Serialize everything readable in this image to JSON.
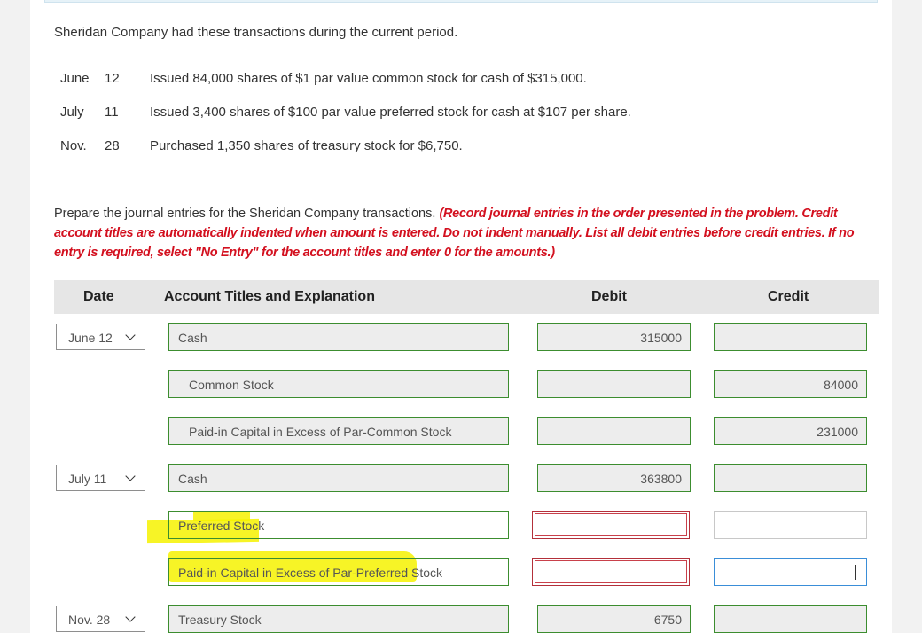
{
  "intro": "Sheridan Company had these transactions during the current period.",
  "transactions": [
    {
      "month": "June",
      "day": "12",
      "desc": "Issued 84,000 shares of $1 par value common stock for cash of $315,000."
    },
    {
      "month": "July",
      "day": "11",
      "desc": "Issued 3,400 shares of $100 par value preferred stock for cash at $107 per share."
    },
    {
      "month": "Nov.",
      "day": "28",
      "desc": "Purchased 1,350 shares of treasury stock for $6,750."
    }
  ],
  "instructions": {
    "plain": "Prepare the journal entries for the Sheridan Company transactions.",
    "red": "(Record journal entries in the order presented in the problem. Credit account titles are automatically indented when amount is entered. Do not indent manually. List all debit entries before credit entries. If no entry is required, select \"No Entry\" for the account titles and enter 0 for the amounts.)"
  },
  "table_headers": {
    "date": "Date",
    "account": "Account Titles and Explanation",
    "debit": "Debit",
    "credit": "Credit"
  },
  "rows": [
    {
      "date": "June 12",
      "account": "Cash",
      "debit": "315000",
      "credit": ""
    },
    {
      "date": "",
      "account": "Common Stock",
      "debit": "",
      "credit": "84000"
    },
    {
      "date": "",
      "account": "Paid-in Capital in Excess of Par-Common Stock",
      "debit": "",
      "credit": "231000"
    },
    {
      "date": "July 11",
      "account": "Cash",
      "debit": "363800",
      "credit": ""
    },
    {
      "date": "",
      "account": "Preferred Stock",
      "debit": "",
      "credit": ""
    },
    {
      "date": "",
      "account": "Paid-in Capital in Excess of Par-Preferred Stock",
      "debit": "",
      "credit": ""
    },
    {
      "date": "Nov. 28",
      "account": "Treasury Stock",
      "debit": "6750",
      "credit": ""
    }
  ],
  "colors": {
    "field_border": "#3c8d2f",
    "error_border": "#b3303a",
    "focus_border": "#3a8ed8",
    "highlight": "#f6f200",
    "instruction_red": "#d3101f"
  }
}
